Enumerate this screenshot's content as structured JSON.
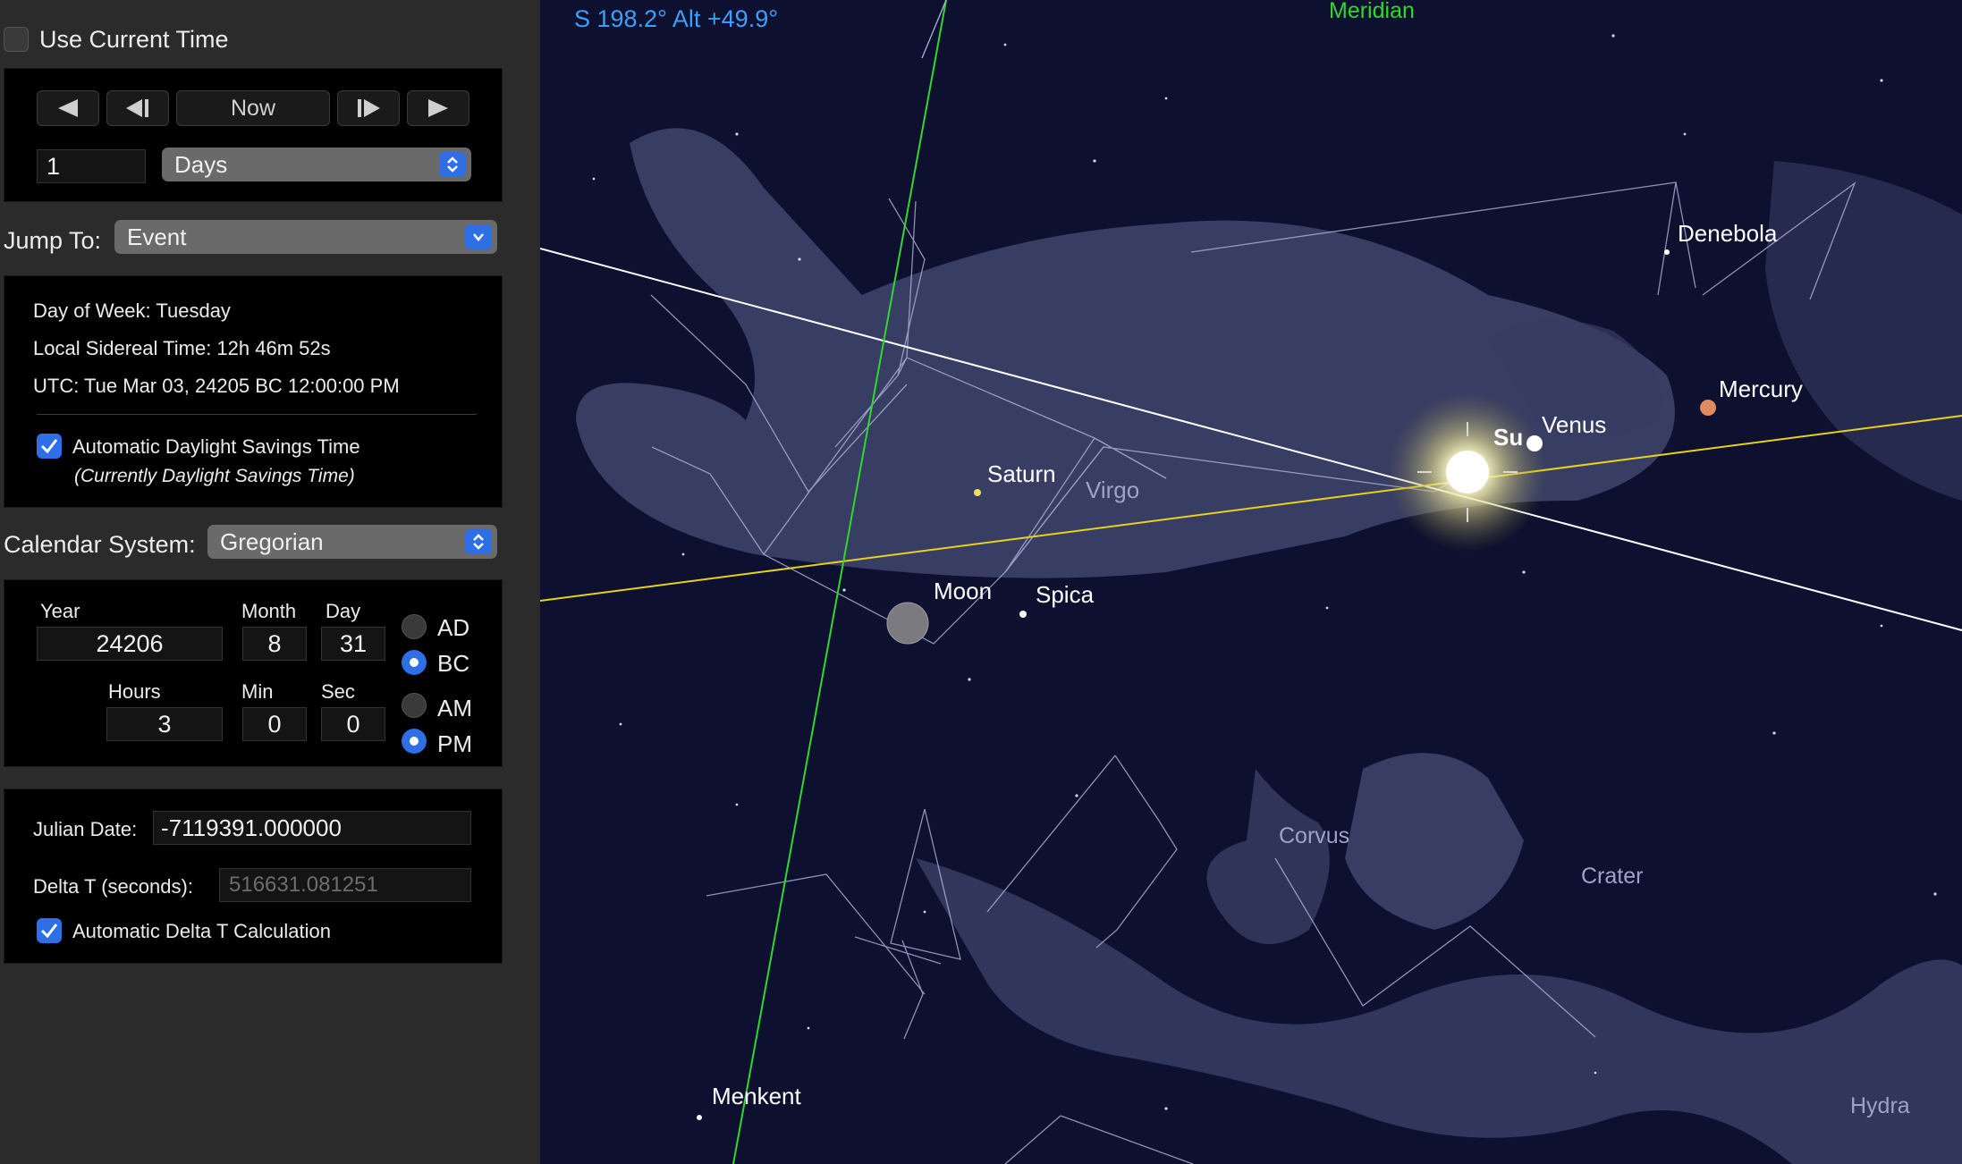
{
  "time_panel": {
    "use_current_time_label": "Use Current Time",
    "use_current_time_checked": false,
    "step_buttons": {
      "now_label": "Now"
    },
    "step_amount": "1",
    "step_unit": "Days",
    "jump_to_label": "Jump To:",
    "jump_to_value": "Event",
    "info": {
      "day_of_week": "Day of Week:  Tuesday",
      "local_sidereal_time": "Local Sidereal Time:  12h 46m 52s",
      "utc": "UTC:  Tue Mar 03, 24205 BC 12:00:00 PM",
      "auto_dst_label": "Automatic Daylight Savings Time",
      "auto_dst_checked": true,
      "dst_note": "(Currently Daylight Savings Time)"
    },
    "calendar_system_label": "Calendar System:",
    "calendar_system_value": "Gregorian",
    "date": {
      "year_label": "Year",
      "year": "24206",
      "month_label": "Month",
      "month": "8",
      "day_label": "Day",
      "day": "31",
      "hours_label": "Hours",
      "hours": "3",
      "min_label": "Min",
      "min": "0",
      "sec_label": "Sec",
      "sec": "0",
      "era_ad": "AD",
      "era_bc": "BC",
      "era_selected": "BC",
      "am": "AM",
      "pm": "PM",
      "ampm_selected": "PM"
    },
    "julian": {
      "julian_date_label": "Julian Date:",
      "julian_date_value": "-7119391.000000",
      "delta_t_label": "Delta T (seconds):",
      "delta_t_value": "516631.081251",
      "auto_delta_t_label": "Automatic Delta T Calculation",
      "auto_delta_t_checked": true
    }
  },
  "sky_view": {
    "direction_readout": "S 198.2° Alt +49.9°",
    "meridian_label": "Meridian",
    "labels": {
      "denebola": "Denebola",
      "mercury": "Mercury",
      "venus": "Venus",
      "sun": "Su",
      "saturn": "Saturn",
      "virgo": "Virgo",
      "moon": "Moon",
      "spica": "Spica",
      "corvus": "Corvus",
      "crater": "Crater",
      "menkent": "Menkent",
      "hydra": "Hydra"
    },
    "colors": {
      "background": "#0d102f",
      "meridian": "#2fd82f",
      "ecliptic": "#e6d21a",
      "equator": "#ffffff",
      "readout": "#3aa0ff"
    }
  }
}
